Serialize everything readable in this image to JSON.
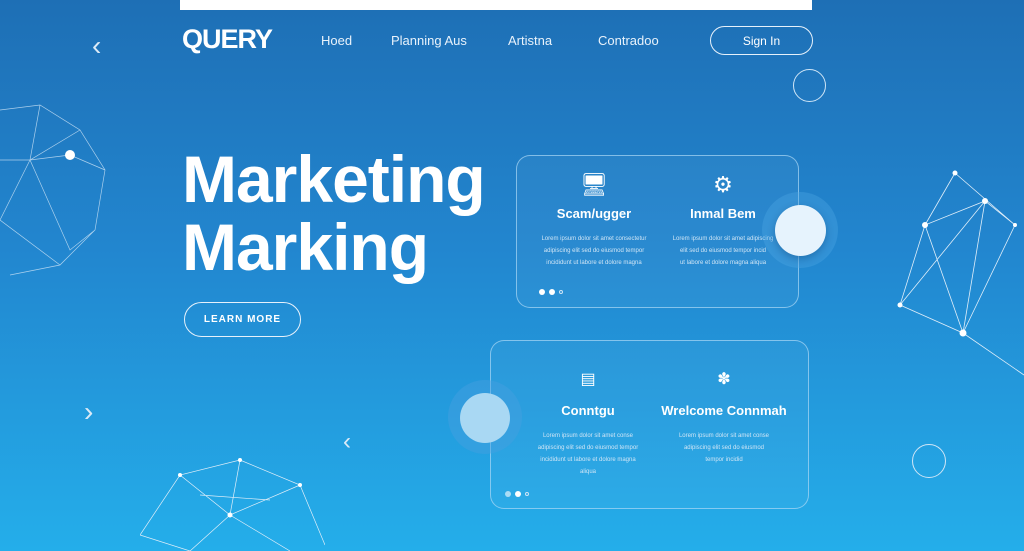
{
  "header": {
    "logo": "QUERY",
    "nav": [
      "Hoed",
      "Planning Aus",
      "Artistna",
      "Contradoo"
    ],
    "signin": "Sign In"
  },
  "hero": {
    "line1": "Marketing",
    "line2": "Marking",
    "cta": "LEARN MORE"
  },
  "cards": [
    {
      "cols": [
        {
          "icon": "monitor-icon",
          "title": "Scam/ugger",
          "text": [
            "Lorem ipsum dolor sit amet consectetur",
            "adipiscing elit sed do eiusmod tempor",
            "incididunt ut labore et dolore magna"
          ]
        },
        {
          "icon": "gears-icon",
          "title": "Inmal Bem",
          "text": [
            "Lorem ipsum dolor sit amet adipiscing",
            "elit sed do eiusmod tempor incid",
            "ut labore et dolore magna aliqua"
          ]
        }
      ]
    },
    {
      "cols": [
        {
          "icon": "router-icon",
          "title": "Conntgu",
          "text": [
            "Lorem ipsum dolor sit amet conse",
            "adipiscing elit sed do eiusmod tempor",
            "incididunt ut labore et dolore magna",
            "aliqua"
          ]
        },
        {
          "icon": "people-icon",
          "title": "Wrelcome Connmah",
          "text": [
            "Lorem ipsum dolor sit amet conse",
            "adipiscing elit sed do eiusmod",
            "tempor incidid"
          ]
        }
      ]
    }
  ]
}
